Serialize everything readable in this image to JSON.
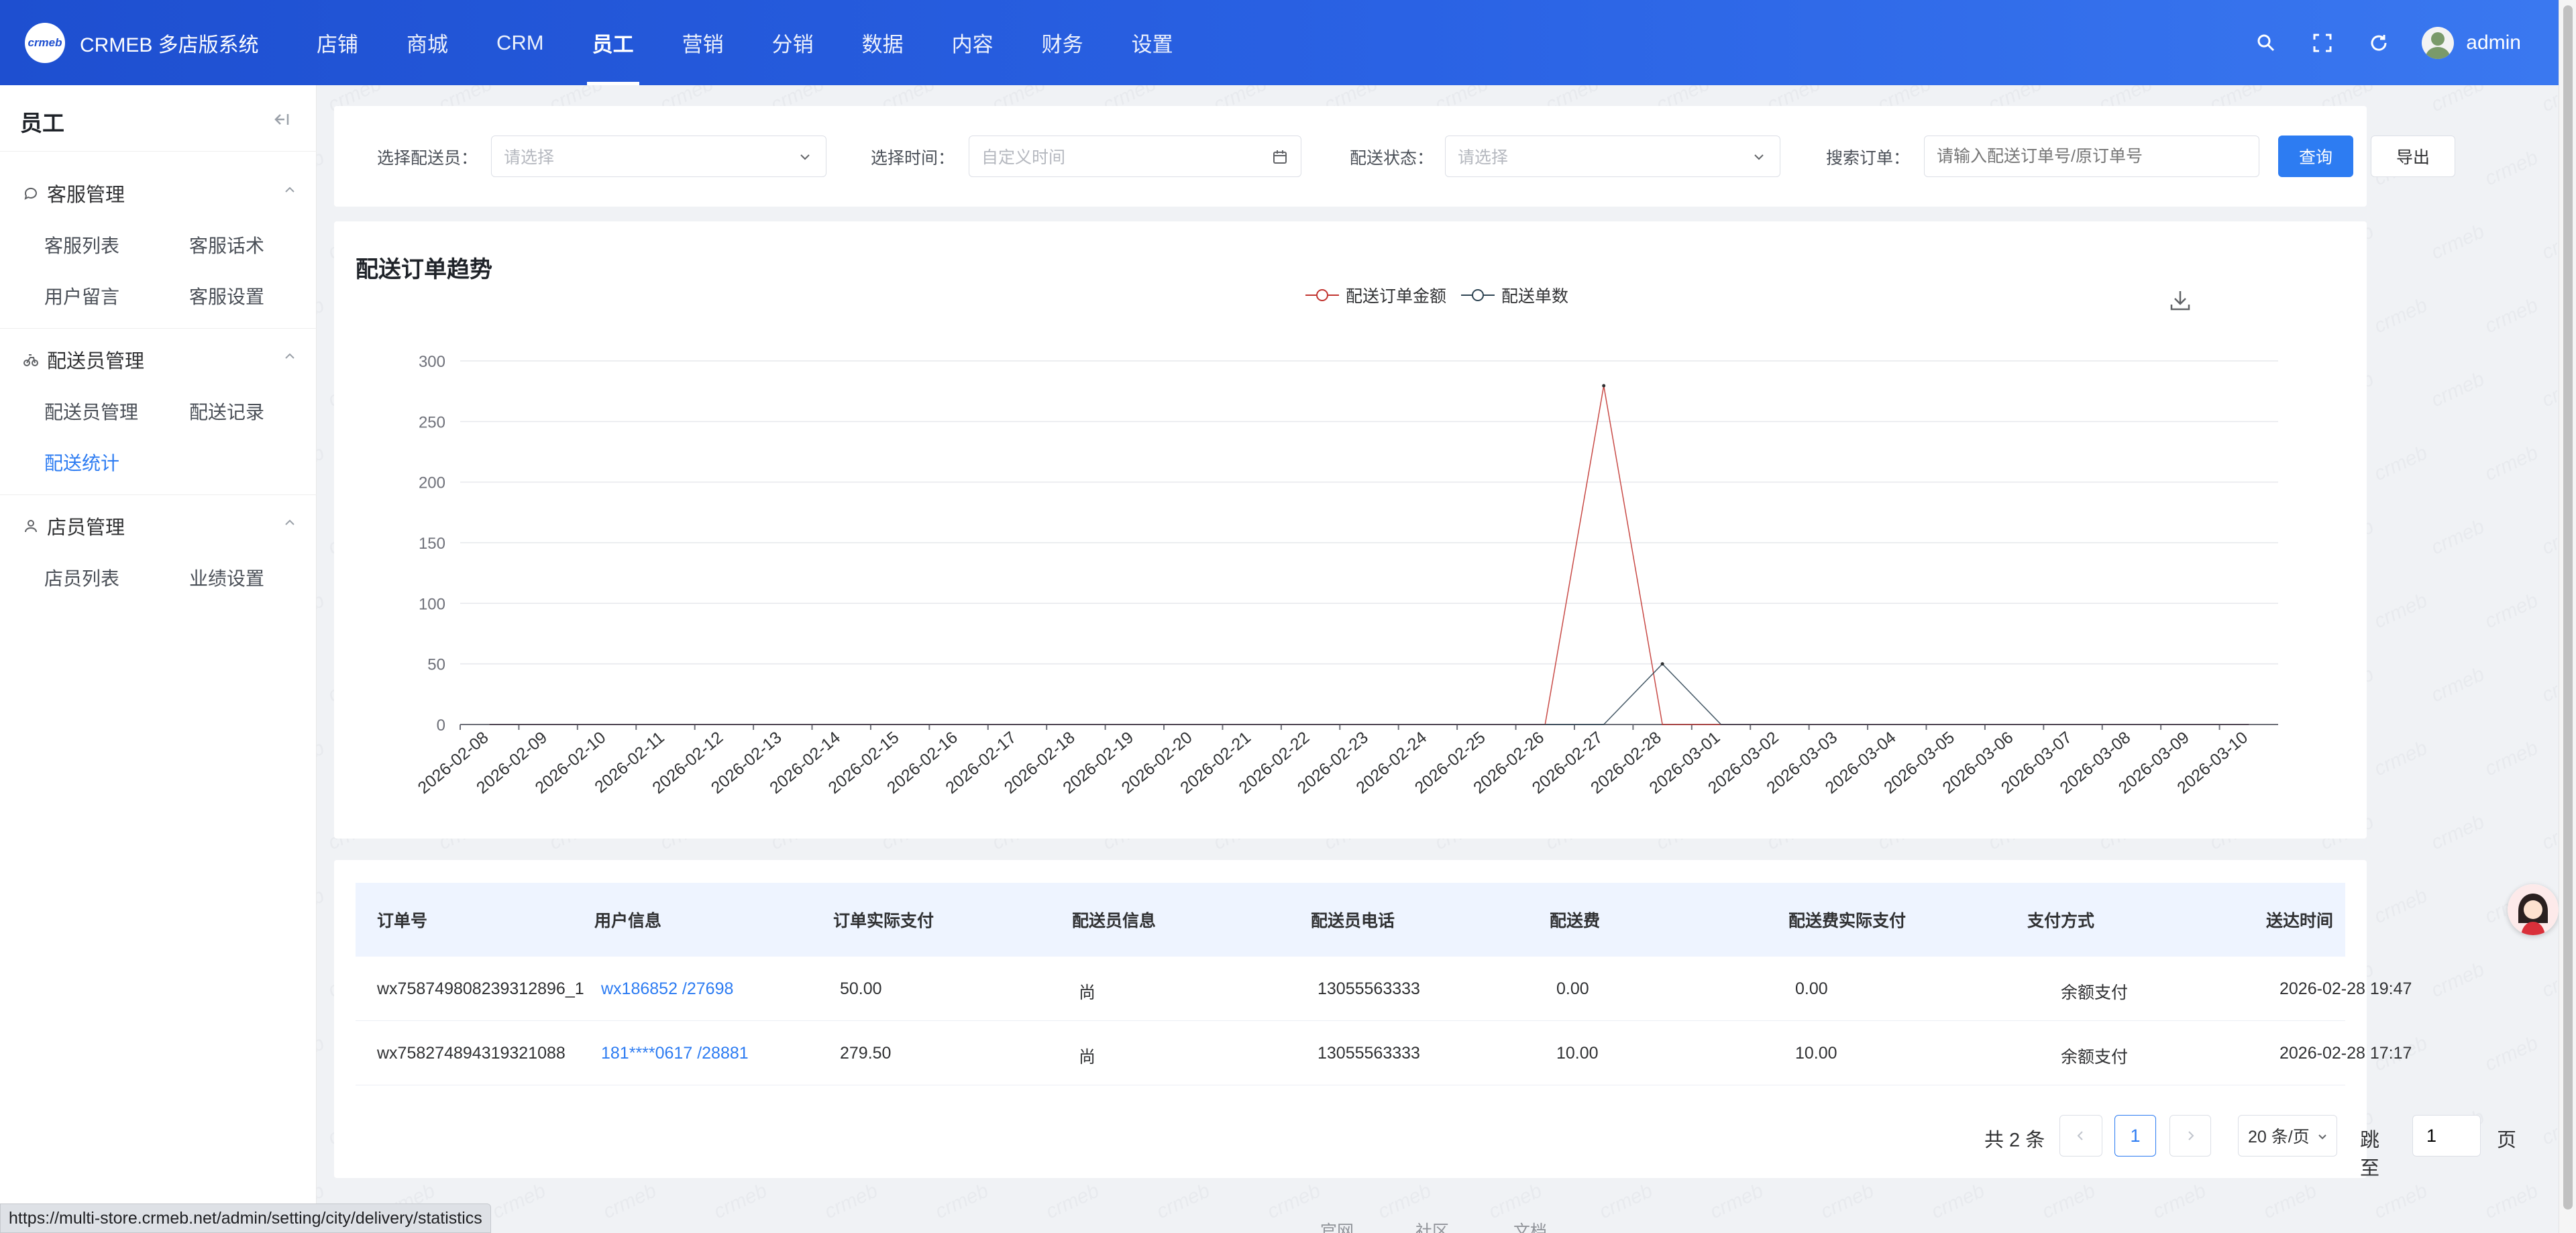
{
  "header": {
    "logo_text": "crmeb",
    "app_name": "CRMEB 多店版系统",
    "nav": [
      "店铺",
      "商城",
      "CRM",
      "员工",
      "营销",
      "分销",
      "数据",
      "内容",
      "财务",
      "设置"
    ],
    "active_nav": "员工",
    "user_name": "admin"
  },
  "sidebar": {
    "title": "员工",
    "groups": [
      {
        "title": "客服管理",
        "items": [
          "客服列表",
          "客服话术",
          "用户留言",
          "客服设置"
        ]
      },
      {
        "title": "配送员管理",
        "items": [
          "配送员管理",
          "配送记录",
          "配送统计"
        ]
      },
      {
        "title": "店员管理",
        "items": [
          "店员列表",
          "业绩设置"
        ]
      }
    ],
    "active_item": "配送统计"
  },
  "filters": {
    "courier_label": "选择配送员：",
    "courier_placeholder": "请选择",
    "time_label": "选择时间：",
    "time_placeholder": "自定义时间",
    "status_label": "配送状态：",
    "status_placeholder": "请选择",
    "search_label": "搜索订单：",
    "search_placeholder": "请输入配送订单号/原订单号",
    "query_button": "查询",
    "export_button": "导出"
  },
  "chart_data": {
    "type": "line",
    "title": "配送订单趋势",
    "x": [
      "2026-02-08",
      "2026-02-09",
      "2026-02-10",
      "2026-02-11",
      "2026-02-12",
      "2026-02-13",
      "2026-02-14",
      "2026-02-15",
      "2026-02-16",
      "2026-02-17",
      "2026-02-18",
      "2026-02-19",
      "2026-02-20",
      "2026-02-21",
      "2026-02-22",
      "2026-02-23",
      "2026-02-24",
      "2026-02-25",
      "2026-02-26",
      "2026-02-27",
      "2026-02-28",
      "2026-03-01",
      "2026-03-02",
      "2026-03-03",
      "2026-03-04",
      "2026-03-05",
      "2026-03-06",
      "2026-03-07",
      "2026-03-08",
      "2026-03-09",
      "2026-03-10"
    ],
    "series": [
      {
        "name": "配送订单金额",
        "color": "#c23531",
        "values": [
          0,
          0,
          0,
          0,
          0,
          0,
          0,
          0,
          0,
          0,
          0,
          0,
          0,
          0,
          0,
          0,
          0,
          0,
          0,
          279.5,
          0,
          0,
          0,
          0,
          0,
          0,
          0,
          0,
          0,
          0,
          0
        ]
      },
      {
        "name": "配送单数",
        "color": "#2f4554",
        "values": [
          0,
          0,
          0,
          0,
          0,
          0,
          0,
          0,
          0,
          0,
          0,
          0,
          0,
          0,
          0,
          0,
          0,
          0,
          0,
          0,
          50,
          0,
          0,
          0,
          0,
          0,
          0,
          0,
          0,
          0,
          0
        ]
      }
    ],
    "yticks": [
      0,
      50,
      100,
      150,
      200,
      250,
      300
    ],
    "ylim": [
      0,
      300
    ],
    "grid": true,
    "legend": "top-center"
  },
  "table": {
    "columns": [
      "订单号",
      "用户信息",
      "订单实际支付",
      "配送员信息",
      "配送员电话",
      "配送费",
      "配送费实际支付",
      "支付方式",
      "送达时间"
    ],
    "rows": [
      [
        "wx758749808239312896_1",
        "wx186852 /27698",
        "50.00",
        "尚",
        "13055563333",
        "0.00",
        "0.00",
        "余额支付",
        "2026-02-28 19:47"
      ],
      [
        "wx758274894319321088",
        "181****0617 /28881",
        "279.50",
        "尚",
        "13055563333",
        "10.00",
        "10.00",
        "余额支付",
        "2026-02-28 17:17"
      ]
    ]
  },
  "pagination": {
    "total_text": "共 2 条",
    "current_page": "1",
    "page_size": "20 条/页",
    "jump_label": "跳至",
    "jump_value": "1",
    "page_unit": "页"
  },
  "footer": {
    "links": [
      "官网",
      "社区",
      "文档"
    ]
  },
  "status_url": "https://multi-store.crmeb.net/admin/setting/city/delivery/statistics",
  "colors": {
    "primary": "#2d7cf2",
    "header_start": "#1e4fd0",
    "header_end": "#3a78f0"
  }
}
